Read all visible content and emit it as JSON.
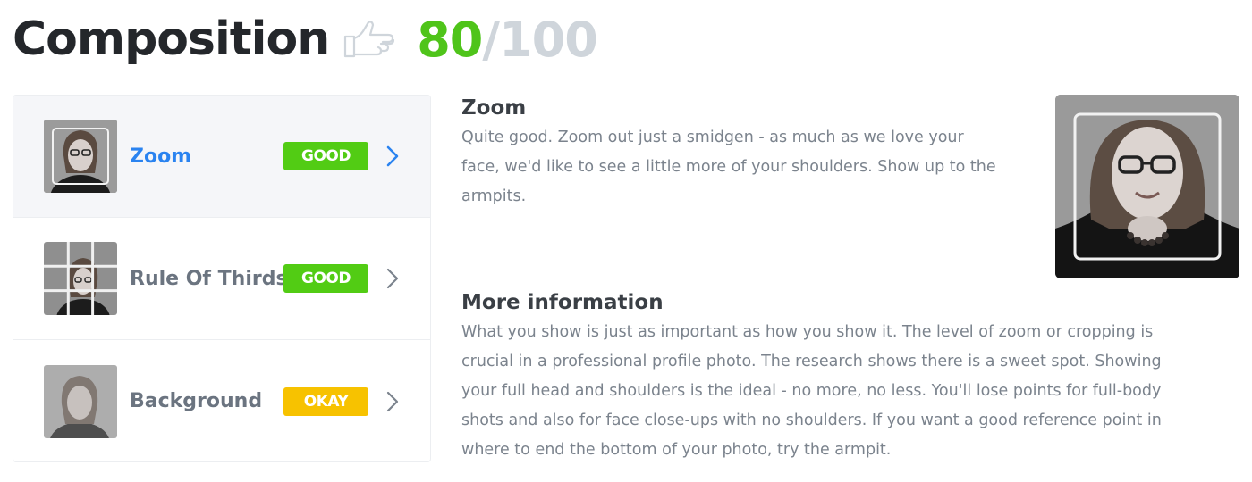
{
  "header": {
    "title": "Composition",
    "icon": "hand-pointing-icon",
    "score_value": "80",
    "score_sep": "/",
    "score_max": "100"
  },
  "colors": {
    "good": "#52cc14",
    "okay": "#f7c200",
    "accent": "#2a83f0",
    "score": "#4fc41a"
  },
  "sidebar": {
    "items": [
      {
        "label": "Zoom",
        "badge": "GOOD",
        "badge_color": "#52cc14",
        "active": true,
        "thumb": "zoom"
      },
      {
        "label": "Rule Of Thirds",
        "badge": "GOOD",
        "badge_color": "#52cc14",
        "active": false,
        "thumb": "thirds"
      },
      {
        "label": "Background",
        "badge": "OKAY",
        "badge_color": "#f7c200",
        "active": false,
        "thumb": "background"
      }
    ]
  },
  "detail": {
    "title": "Zoom",
    "line1": "Quite good. Zoom out just a smidgen - as much as we love your",
    "line2": "face, we'd like to see a little more of your shoulders. Show up to the",
    "line3": "armpits."
  },
  "more": {
    "title": "More information",
    "line1": "What you show is just as important as how you show it. The level of zoom or cropping is",
    "line2": "crucial in a professional profile photo. The research shows there is a sweet spot. Showing",
    "line3": "your full head and shoulders is the ideal - no more, no less. You'll lose points for full-body",
    "line4": "shots and also for face close-ups with no shoulders. If you want a good reference point in",
    "line5": "where to end the bottom of your photo, try the armpit."
  }
}
